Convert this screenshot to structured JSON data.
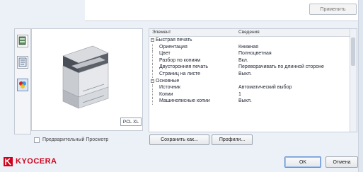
{
  "top": {
    "apply_label": "Применить"
  },
  "preview": {
    "pcl_label": "PCL XL"
  },
  "table": {
    "col_item": "Элемент",
    "col_value": "Сведения",
    "rows": [
      {
        "kind": "group",
        "item": "Быстрая печать",
        "value": ""
      },
      {
        "kind": "item",
        "item": "Ориентация",
        "value": "Книжная"
      },
      {
        "kind": "item",
        "item": "Цвет",
        "value": "Полноцветная"
      },
      {
        "kind": "item",
        "item": "Разбор по копиям",
        "value": "Вкл."
      },
      {
        "kind": "item",
        "item": "Двусторонняя печать",
        "value": "Переворачивать по длинной стороне"
      },
      {
        "kind": "item",
        "item": "Страниц на листе",
        "value": "Выкл."
      },
      {
        "kind": "group",
        "item": "Основные",
        "value": ""
      },
      {
        "kind": "item",
        "item": "Источник",
        "value": "Автоматический выбор"
      },
      {
        "kind": "item",
        "item": "Копии",
        "value": "1"
      },
      {
        "kind": "item",
        "item": "Машинописные копии",
        "value": "Выкл."
      }
    ]
  },
  "bottom": {
    "preview_check_label": "Предварительный Просмотр",
    "save_as_label": "Сохранить как...",
    "profiles_label": "Профили..."
  },
  "footer": {
    "brand": "KYOCERA",
    "ok_label": "OK",
    "cancel_label": "Отмена"
  },
  "colors": {
    "brand_red": "#d0021b",
    "ok_focus": "#5b8ad0"
  },
  "icons": [
    "printer-tab-icon",
    "document-tab-icon",
    "color-tab-icon",
    "kyocera-logo-icon"
  ]
}
